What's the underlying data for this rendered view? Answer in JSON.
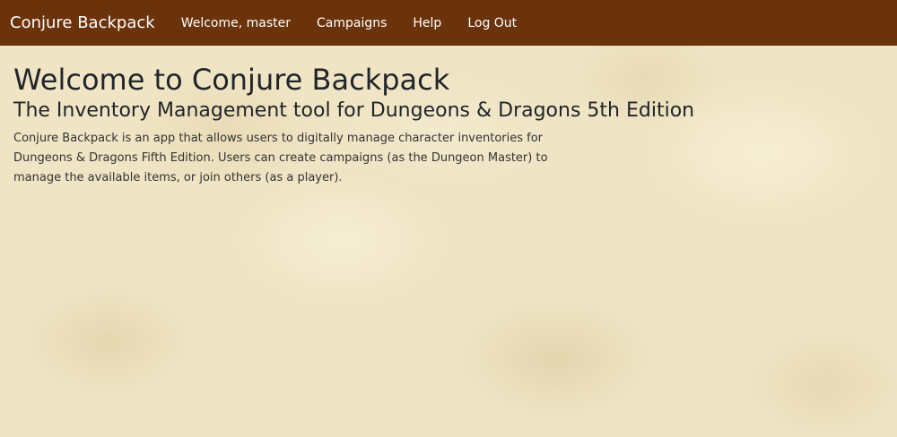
{
  "navbar": {
    "brand": "Conjure Backpack",
    "links": [
      {
        "label": "Welcome, master"
      },
      {
        "label": "Campaigns"
      },
      {
        "label": "Help"
      },
      {
        "label": "Log Out"
      }
    ],
    "background_color": "#6b330b"
  },
  "main": {
    "title": "Welcome to Conjure Backpack",
    "subtitle": "The Inventory Management tool for Dungeons & Dragons 5th Edition",
    "description": "Conjure Backpack is an app that allows users to digitally manage character inventories for Dungeons & Dragons Fifth Edition. Users can create campaigns (as the Dungeon Master) to manage the available items, or join others (as a player)."
  },
  "theme": {
    "page_background": "#efe4c4",
    "text_color": "#212529"
  }
}
